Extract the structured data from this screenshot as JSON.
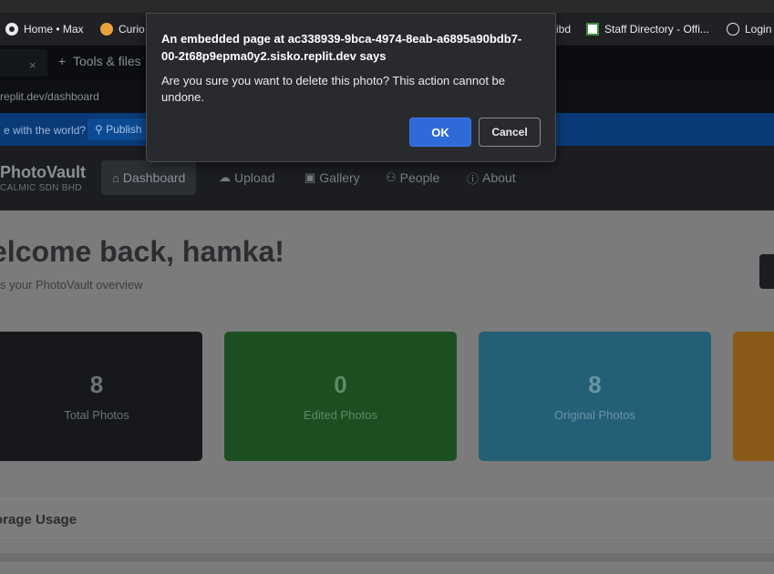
{
  "bookmarks": [
    {
      "label": "Home • Max",
      "icon": "circle-logo-icon"
    },
    {
      "label": "Curio",
      "icon": "curio-icon"
    },
    {
      "label": "ibd",
      "icon": ""
    },
    {
      "label": "Staff Directory - Offi...",
      "icon": "staff-directory-icon"
    },
    {
      "label": "Login",
      "icon": "globe-icon"
    }
  ],
  "replit": {
    "tab_close": "×",
    "tools_label": "Tools & files",
    "url_text": "replit.dev/dashboard",
    "banner_text": "e with the world?",
    "publish_label": "Publish"
  },
  "app": {
    "brand": "PhotoVault",
    "brand_sub": "CALMIC SDN BHD",
    "nav": [
      {
        "label": "Dashboard",
        "icon": "home-icon",
        "active": true
      },
      {
        "label": "Upload",
        "icon": "cloud-upload-icon"
      },
      {
        "label": "Gallery",
        "icon": "image-icon"
      },
      {
        "label": "People",
        "icon": "people-icon"
      },
      {
        "label": "About",
        "icon": "info-icon"
      }
    ],
    "welcome": "elcome back, hamka!",
    "subtitle": "s your PhotoVault overview",
    "stats": [
      {
        "value": "8",
        "label": "Total Photos"
      },
      {
        "value": "0",
        "label": "Edited Photos"
      },
      {
        "value": "8",
        "label": "Original Photos"
      }
    ],
    "storage_title": "orage Usage"
  },
  "dialog": {
    "title": "An embedded page at ac338939-9bca-4974-8eab-a6895a90bdb7-00-2t68p9epma0y2.sisko.replit.dev says",
    "message": "Are you sure you want to delete this photo? This action cannot be undone.",
    "ok_label": "OK",
    "cancel_label": "Cancel"
  },
  "colors": {
    "ok_button": "#2f6ad9",
    "dialog_bg": "#292a2d",
    "card_dark": "#16181b",
    "card_green": "#1b4f22",
    "card_teal": "#235f76",
    "card_orange": "#8a5b18"
  }
}
